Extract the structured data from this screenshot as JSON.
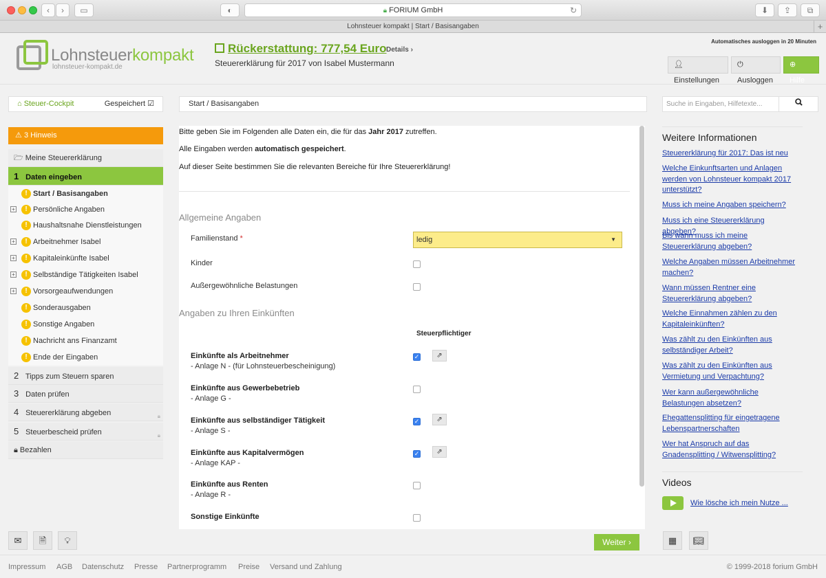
{
  "browser": {
    "url_label": "FORIUM GmbH",
    "tab_title": "Lohnsteuer kompakt | Start / Basisangaben"
  },
  "header": {
    "logo_part1": "Lohnsteuer",
    "logo_part2": "kompakt",
    "logo_sub": "lohnsteuer-kompakt.de",
    "refund": "Rückerstattung: 777,54 Euro",
    "details": "Details",
    "subtitle": "Steuererklärung für 2017 von Isabel Mustermann",
    "autologout": "Automatisches ausloggen in 20 Minuten",
    "settings": "Einstellungen",
    "logout": "Ausloggen",
    "help": "Hilfe"
  },
  "sidebar": {
    "cockpit": "Steuer-Cockpit",
    "saved": "Gespeichert",
    "hint": "3 Hinweis",
    "my_return": "Meine Steuererklärung",
    "steps": [
      {
        "num": "1",
        "label": "Daten eingeben"
      },
      {
        "num": "2",
        "label": "Tipps zum Steuern sparen"
      },
      {
        "num": "3",
        "label": "Daten prüfen"
      },
      {
        "num": "4",
        "label": "Steuererklärung abgeben"
      },
      {
        "num": "5",
        "label": "Steuerbescheid prüfen"
      }
    ],
    "pay": "Bezahlen",
    "sub_items": [
      {
        "label": "Start / Basisangaben"
      },
      {
        "label": "Persönliche Angaben"
      },
      {
        "label": "Haushaltsnahe Dienstleistungen"
      },
      {
        "label": "Arbeitnehmer Isabel"
      },
      {
        "label": "Kapitaleinkünfte Isabel"
      },
      {
        "label": "Selbständige Tätigkeiten Isabel"
      },
      {
        "label": "Vorsorgeaufwendungen"
      },
      {
        "label": "Sonderausgaben"
      },
      {
        "label": "Sonstige Angaben"
      },
      {
        "label": "Nachricht ans Finanzamt"
      },
      {
        "label": "Ende der Eingaben"
      }
    ]
  },
  "breadcrumb": "Start / Basisangaben",
  "main": {
    "intro1_a": "Bitte geben Sie im Folgenden alle Daten ein, die für das ",
    "intro1_b": "Jahr 2017",
    "intro1_c": " zutreffen.",
    "intro2_a": "Alle Eingaben werden ",
    "intro2_b": "automatisch gespeichert",
    "intro2_c": ".",
    "intro3": "Auf dieser Seite bestimmen Sie die relevanten Bereiche für Ihre Steuererklärung!",
    "section1": "Allgemeine Angaben",
    "familienstand_label": "Familienstand",
    "familienstand_value": "ledig",
    "kinder_label": "Kinder",
    "belastungen_label": "Außergewöhnliche Belastungen",
    "section2": "Angaben zu Ihren Einkünften",
    "col_head": "Steuerpflichtiger",
    "incomes": [
      {
        "title": "Einkünfte als Arbeitnehmer",
        "sub": "- Anlage N - (für Lohnsteuerbescheinigung)"
      },
      {
        "title": "Einkünfte aus Gewerbebetrieb",
        "sub": "- Anlage G -"
      },
      {
        "title": "Einkünfte aus selbständiger Tätigkeit",
        "sub": "- Anlage S -"
      },
      {
        "title": "Einkünfte aus Kapitalvermögen",
        "sub": "- Anlage KAP -"
      },
      {
        "title": "Einkünfte aus Renten",
        "sub": "- Anlage R -"
      },
      {
        "title": "Sonstige Einkünfte",
        "sub": ""
      }
    ],
    "next": "Weiter"
  },
  "right": {
    "search_placeholder": "Suche in Eingaben, Hilfetexte...",
    "info_title": "Weitere Informationen",
    "links": [
      "Steuererklärung für 2017: Das ist neu",
      "Welche Einkunftsarten und Anlagen werden von Lohnsteuer kompakt 2017 unterstützt?",
      "Muss ich meine Angaben speichern?",
      "Muss ich eine Steuererklärung abgeben?",
      "Bis wann muss ich meine Steuererklärung abgeben?",
      "Welche Angaben müssen Arbeitnehmer machen?",
      "Wann müssen Rentner eine Steuererklärung abgeben?",
      "Welche Einnahmen zählen zu den Kapitaleinkünften?",
      "Was zählt zu den Einkünften aus selbständiger Arbeit?",
      "Was zählt zu den Einkünften aus Vermietung und Verpachtung?",
      "Wer kann außergewöhnliche Belastungen absetzen?",
      "Ehegattensplitting für eingetragene Lebenspartnerschaften",
      "Wer hat Anspruch auf das Gnadensplitting / Witwensplitting?"
    ],
    "videos_title": "Videos",
    "video_link": "Wie lösche ich mein Nutze ..."
  },
  "footer": {
    "links": [
      "Impressum",
      "AGB",
      "Datenschutz",
      "Presse",
      "Partnerprogramm",
      "Preise",
      "Versand und Zahlung"
    ],
    "copyright": "© 1999-2018 forium GmbH"
  }
}
